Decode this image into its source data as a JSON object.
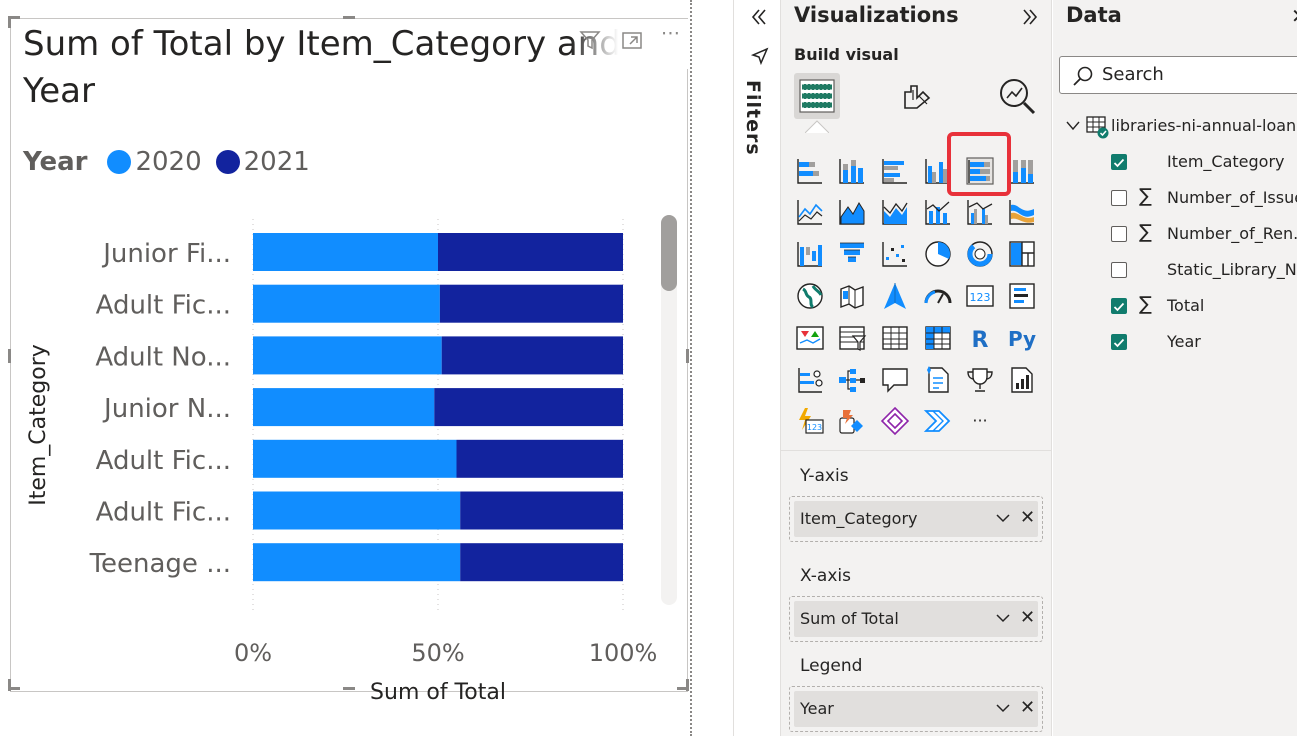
{
  "visual": {
    "title": "Sum of Total by Item_Category and Year",
    "legend": {
      "title": "Year",
      "items": [
        {
          "label": "2020",
          "color": "#118dff"
        },
        {
          "label": "2021",
          "color": "#12239e"
        }
      ]
    }
  },
  "chart_data": {
    "type": "bar",
    "orientation": "horizontal",
    "stacking": "100%",
    "categories": [
      "Junior Fi...",
      "Adult Fic...",
      "Adult No...",
      "Junior N...",
      "Adult Fic...",
      "Adult Fic...",
      "Teenage ..."
    ],
    "series": [
      {
        "name": "2020",
        "values": [
          50,
          50.5,
          51,
          49,
          55,
          56,
          56
        ],
        "color": "#118dff"
      },
      {
        "name": "2021",
        "values": [
          50,
          49.5,
          49,
          51,
          45,
          44,
          44
        ],
        "color": "#12239e"
      }
    ],
    "xlabel": "Sum of Total",
    "ylabel": "Item_Category",
    "x_ticks": [
      "0%",
      "50%",
      "100%"
    ],
    "xlim": [
      0,
      100
    ],
    "grid": "vertical dotted",
    "legend_position": "top-left"
  },
  "filters": {
    "label": "Filters"
  },
  "viz_pane": {
    "title": "Visualizations",
    "build_label": "Build visual",
    "more_label": "...",
    "wells": [
      {
        "label": "Y-axis",
        "field": "Item_Category"
      },
      {
        "label": "X-axis",
        "field": "Sum of Total"
      },
      {
        "label": "Legend",
        "field": "Year"
      }
    ]
  },
  "data_pane": {
    "title": "Data",
    "search_placeholder": "Search",
    "table_name": "libraries-ni-annual-loans",
    "fields": [
      {
        "name": "Item_Category",
        "checked": true,
        "sigma": false
      },
      {
        "name": "Number_of_Issues",
        "checked": false,
        "sigma": true
      },
      {
        "name": "Number_of_Ren...",
        "checked": false,
        "sigma": true
      },
      {
        "name": "Static_Library_Name",
        "checked": false,
        "sigma": false
      },
      {
        "name": "Total",
        "checked": true,
        "sigma": true
      },
      {
        "name": "Year",
        "checked": true,
        "sigma": false
      }
    ]
  },
  "colors": {
    "accent": "#107c6d",
    "highlight": "#e8313a"
  }
}
